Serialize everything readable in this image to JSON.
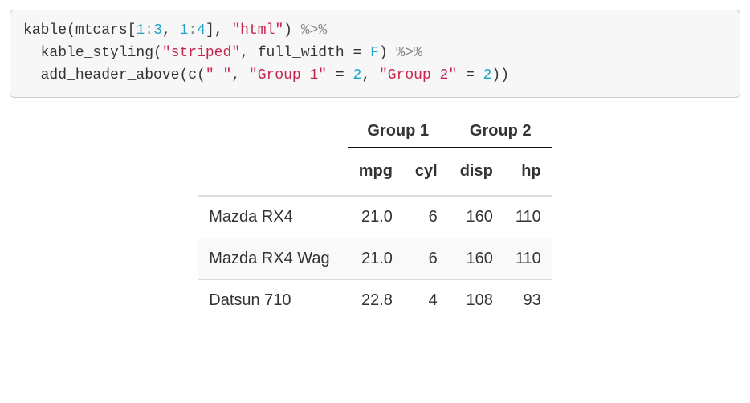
{
  "code": {
    "fn_kable": "kable",
    "ds": "mtcars",
    "lb": "[",
    "rng1a": "1",
    "colon": ":",
    "rng1b": "3",
    "comma": ", ",
    "rng2a": "1",
    "rng2b": "4",
    "rb": "]",
    "str_html": "\"html\"",
    "pipe": " %>%",
    "fn_styling": "kable_styling",
    "str_striped": "\"striped\"",
    "arg_fullwidth": "full_width",
    "eq": " = ",
    "val_F": "F",
    "fn_addheader": "add_header_above",
    "fn_c": "c",
    "str_blank": "\" \"",
    "str_g1": "\"Group 1\"",
    "str_g2": "\"Group 2\"",
    "val_2a": "2",
    "val_2b": "2",
    "lp": "(",
    "rp": ")",
    "indent": "  "
  },
  "chart_data": {
    "type": "table",
    "group_headers": [
      {
        "label": "",
        "span": 1
      },
      {
        "label": "Group 1",
        "span": 2
      },
      {
        "label": "Group 2",
        "span": 2
      }
    ],
    "columns": [
      "",
      "mpg",
      "cyl",
      "disp",
      "hp"
    ],
    "rows": [
      {
        "name": "Mazda RX4",
        "values": [
          "21.0",
          "6",
          "160",
          "110"
        ]
      },
      {
        "name": "Mazda RX4 Wag",
        "values": [
          "21.0",
          "6",
          "160",
          "110"
        ]
      },
      {
        "name": "Datsun 710",
        "values": [
          "22.8",
          "4",
          "108",
          "93"
        ]
      }
    ]
  }
}
